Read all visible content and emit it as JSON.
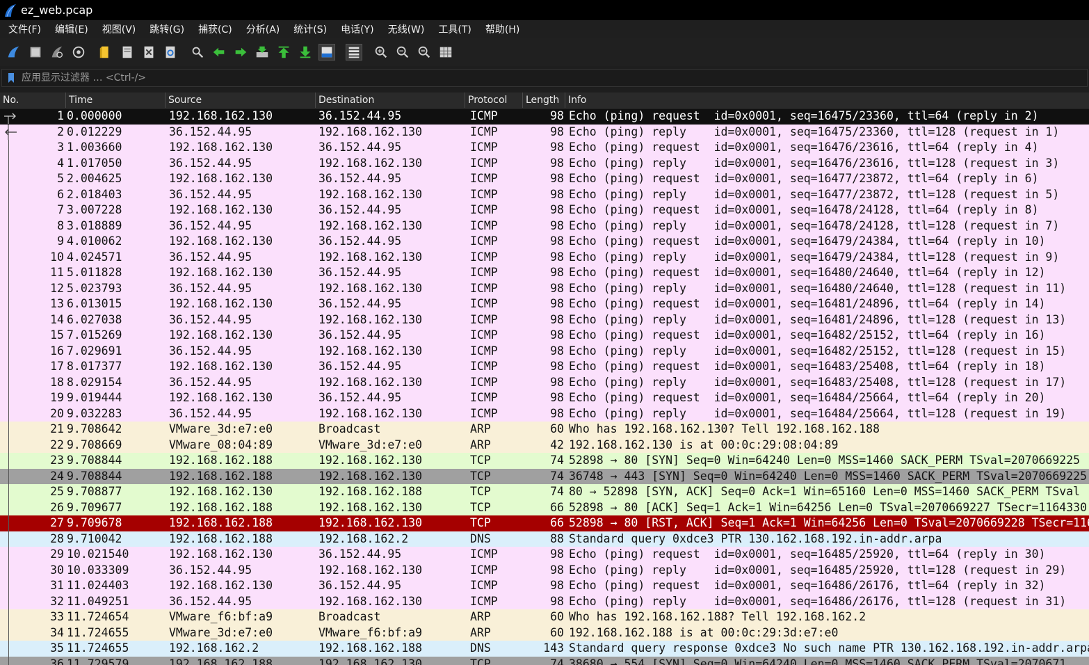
{
  "window": {
    "title": "ez_web.pcap"
  },
  "menu": [
    "文件(F)",
    "编辑(E)",
    "视图(V)",
    "跳转(G)",
    "捕获(C)",
    "分析(A)",
    "统计(S)",
    "电话(Y)",
    "无线(W)",
    "工具(T)",
    "帮助(H)"
  ],
  "toolbar": [
    {
      "name": "start-capture-icon"
    },
    {
      "name": "stop-capture-icon"
    },
    {
      "name": "restart-capture-icon"
    },
    {
      "name": "capture-options-icon"
    },
    {
      "name": "open-file-icon",
      "sep": true
    },
    {
      "name": "save-file-icon"
    },
    {
      "name": "close-file-icon"
    },
    {
      "name": "reload-file-icon"
    },
    {
      "name": "find-packet-icon",
      "sep": true
    },
    {
      "name": "go-back-icon"
    },
    {
      "name": "go-forward-icon"
    },
    {
      "name": "go-to-packet-icon"
    },
    {
      "name": "go-first-packet-icon"
    },
    {
      "name": "go-last-packet-icon"
    },
    {
      "name": "auto-scroll-icon",
      "active": true
    },
    {
      "name": "colorize-icon",
      "sep": true,
      "active": true
    },
    {
      "name": "zoom-in-icon",
      "sep": true
    },
    {
      "name": "zoom-out-icon"
    },
    {
      "name": "zoom-normal-icon"
    },
    {
      "name": "resize-columns-icon"
    }
  ],
  "filter": {
    "placeholder": "应用显示过滤器 … <Ctrl-/>"
  },
  "columns": [
    "No.",
    "Time",
    "Source",
    "Destination",
    "Protocol",
    "Length",
    "Info"
  ],
  "colors": {
    "icmp": "#fbe0fc",
    "arp": "#f9f0d8",
    "tcp": "#e3fbcf",
    "tcp_dim": "#a0a0a0",
    "tcp_rst": "#a50000",
    "dns": "#daeffb",
    "selected": "#101010"
  },
  "packets": [
    {
      "no": "1",
      "time": "0.000000",
      "src": "192.168.162.130",
      "dst": "36.152.44.95",
      "proto": "ICMP",
      "len": "98",
      "info": "Echo (ping) request  id=0x0001, seq=16475/23360, ttl=64 (reply in 2)",
      "color": "selected",
      "rel": "req"
    },
    {
      "no": "2",
      "time": "0.012229",
      "src": "36.152.44.95",
      "dst": "192.168.162.130",
      "proto": "ICMP",
      "len": "98",
      "info": "Echo (ping) reply    id=0x0001, seq=16475/23360, ttl=128 (request in 1)",
      "color": "icmp",
      "rel": "resp"
    },
    {
      "no": "3",
      "time": "1.003660",
      "src": "192.168.162.130",
      "dst": "36.152.44.95",
      "proto": "ICMP",
      "len": "98",
      "info": "Echo (ping) request  id=0x0001, seq=16476/23616, ttl=64 (reply in 4)",
      "color": "icmp",
      "rel": "line"
    },
    {
      "no": "4",
      "time": "1.017050",
      "src": "36.152.44.95",
      "dst": "192.168.162.130",
      "proto": "ICMP",
      "len": "98",
      "info": "Echo (ping) reply    id=0x0001, seq=16476/23616, ttl=128 (request in 3)",
      "color": "icmp",
      "rel": "line"
    },
    {
      "no": "5",
      "time": "2.004625",
      "src": "192.168.162.130",
      "dst": "36.152.44.95",
      "proto": "ICMP",
      "len": "98",
      "info": "Echo (ping) request  id=0x0001, seq=16477/23872, ttl=64 (reply in 6)",
      "color": "icmp",
      "rel": "line"
    },
    {
      "no": "6",
      "time": "2.018403",
      "src": "36.152.44.95",
      "dst": "192.168.162.130",
      "proto": "ICMP",
      "len": "98",
      "info": "Echo (ping) reply    id=0x0001, seq=16477/23872, ttl=128 (request in 5)",
      "color": "icmp",
      "rel": "line"
    },
    {
      "no": "7",
      "time": "3.007228",
      "src": "192.168.162.130",
      "dst": "36.152.44.95",
      "proto": "ICMP",
      "len": "98",
      "info": "Echo (ping) request  id=0x0001, seq=16478/24128, ttl=64 (reply in 8)",
      "color": "icmp",
      "rel": "line"
    },
    {
      "no": "8",
      "time": "3.018889",
      "src": "36.152.44.95",
      "dst": "192.168.162.130",
      "proto": "ICMP",
      "len": "98",
      "info": "Echo (ping) reply    id=0x0001, seq=16478/24128, ttl=128 (request in 7)",
      "color": "icmp",
      "rel": "line"
    },
    {
      "no": "9",
      "time": "4.010062",
      "src": "192.168.162.130",
      "dst": "36.152.44.95",
      "proto": "ICMP",
      "len": "98",
      "info": "Echo (ping) request  id=0x0001, seq=16479/24384, ttl=64 (reply in 10)",
      "color": "icmp",
      "rel": "line"
    },
    {
      "no": "10",
      "time": "4.024571",
      "src": "36.152.44.95",
      "dst": "192.168.162.130",
      "proto": "ICMP",
      "len": "98",
      "info": "Echo (ping) reply    id=0x0001, seq=16479/24384, ttl=128 (request in 9)",
      "color": "icmp",
      "rel": "line"
    },
    {
      "no": "11",
      "time": "5.011828",
      "src": "192.168.162.130",
      "dst": "36.152.44.95",
      "proto": "ICMP",
      "len": "98",
      "info": "Echo (ping) request  id=0x0001, seq=16480/24640, ttl=64 (reply in 12)",
      "color": "icmp",
      "rel": "line"
    },
    {
      "no": "12",
      "time": "5.023793",
      "src": "36.152.44.95",
      "dst": "192.168.162.130",
      "proto": "ICMP",
      "len": "98",
      "info": "Echo (ping) reply    id=0x0001, seq=16480/24640, ttl=128 (request in 11)",
      "color": "icmp",
      "rel": "line"
    },
    {
      "no": "13",
      "time": "6.013015",
      "src": "192.168.162.130",
      "dst": "36.152.44.95",
      "proto": "ICMP",
      "len": "98",
      "info": "Echo (ping) request  id=0x0001, seq=16481/24896, ttl=64 (reply in 14)",
      "color": "icmp",
      "rel": "line"
    },
    {
      "no": "14",
      "time": "6.027038",
      "src": "36.152.44.95",
      "dst": "192.168.162.130",
      "proto": "ICMP",
      "len": "98",
      "info": "Echo (ping) reply    id=0x0001, seq=16481/24896, ttl=128 (request in 13)",
      "color": "icmp",
      "rel": "line"
    },
    {
      "no": "15",
      "time": "7.015269",
      "src": "192.168.162.130",
      "dst": "36.152.44.95",
      "proto": "ICMP",
      "len": "98",
      "info": "Echo (ping) request  id=0x0001, seq=16482/25152, ttl=64 (reply in 16)",
      "color": "icmp",
      "rel": "line"
    },
    {
      "no": "16",
      "time": "7.029691",
      "src": "36.152.44.95",
      "dst": "192.168.162.130",
      "proto": "ICMP",
      "len": "98",
      "info": "Echo (ping) reply    id=0x0001, seq=16482/25152, ttl=128 (request in 15)",
      "color": "icmp",
      "rel": "line"
    },
    {
      "no": "17",
      "time": "8.017377",
      "src": "192.168.162.130",
      "dst": "36.152.44.95",
      "proto": "ICMP",
      "len": "98",
      "info": "Echo (ping) request  id=0x0001, seq=16483/25408, ttl=64 (reply in 18)",
      "color": "icmp",
      "rel": "line"
    },
    {
      "no": "18",
      "time": "8.029154",
      "src": "36.152.44.95",
      "dst": "192.168.162.130",
      "proto": "ICMP",
      "len": "98",
      "info": "Echo (ping) reply    id=0x0001, seq=16483/25408, ttl=128 (request in 17)",
      "color": "icmp",
      "rel": "line"
    },
    {
      "no": "19",
      "time": "9.019444",
      "src": "192.168.162.130",
      "dst": "36.152.44.95",
      "proto": "ICMP",
      "len": "98",
      "info": "Echo (ping) request  id=0x0001, seq=16484/25664, ttl=64 (reply in 20)",
      "color": "icmp",
      "rel": "line"
    },
    {
      "no": "20",
      "time": "9.032283",
      "src": "36.152.44.95",
      "dst": "192.168.162.130",
      "proto": "ICMP",
      "len": "98",
      "info": "Echo (ping) reply    id=0x0001, seq=16484/25664, ttl=128 (request in 19)",
      "color": "icmp",
      "rel": "line"
    },
    {
      "no": "21",
      "time": "9.708642",
      "src": "VMware_3d:e7:e0",
      "dst": "Broadcast",
      "proto": "ARP",
      "len": "60",
      "info": "Who has 192.168.162.130? Tell 192.168.162.188",
      "color": "arp",
      "rel": "line"
    },
    {
      "no": "22",
      "time": "9.708669",
      "src": "VMware_08:04:89",
      "dst": "VMware_3d:e7:e0",
      "proto": "ARP",
      "len": "42",
      "info": "192.168.162.130 is at 00:0c:29:08:04:89",
      "color": "arp",
      "rel": "line"
    },
    {
      "no": "23",
      "time": "9.708844",
      "src": "192.168.162.188",
      "dst": "192.168.162.130",
      "proto": "TCP",
      "len": "74",
      "info": "52898 → 80 [SYN] Seq=0 Win=64240 Len=0 MSS=1460 SACK_PERM TSval=2070669225",
      "color": "tcp",
      "rel": "line"
    },
    {
      "no": "24",
      "time": "9.708844",
      "src": "192.168.162.188",
      "dst": "192.168.162.130",
      "proto": "TCP",
      "len": "74",
      "info": "36748 → 443 [SYN] Seq=0 Win=64240 Len=0 MSS=1460 SACK_PERM TSval=2070669225",
      "color": "tcp_dim",
      "rel": "line"
    },
    {
      "no": "25",
      "time": "9.708877",
      "src": "192.168.162.130",
      "dst": "192.168.162.188",
      "proto": "TCP",
      "len": "74",
      "info": "80 → 52898 [SYN, ACK] Seq=0 Ack=1 Win=65160 Len=0 MSS=1460 SACK_PERM TSval",
      "color": "tcp",
      "rel": "line"
    },
    {
      "no": "26",
      "time": "9.709677",
      "src": "192.168.162.188",
      "dst": "192.168.162.130",
      "proto": "TCP",
      "len": "66",
      "info": "52898 → 80 [ACK] Seq=1 Ack=1 Win=64256 Len=0 TSval=2070669227 TSecr=1164330",
      "color": "tcp",
      "rel": "line"
    },
    {
      "no": "27",
      "time": "9.709678",
      "src": "192.168.162.188",
      "dst": "192.168.162.130",
      "proto": "TCP",
      "len": "66",
      "info": "52898 → 80 [RST, ACK] Seq=1 Ack=1 Win=64256 Len=0 TSval=2070669228 TSecr=116",
      "color": "tcp_rst",
      "rel": "line"
    },
    {
      "no": "28",
      "time": "9.710042",
      "src": "192.168.162.188",
      "dst": "192.168.162.2",
      "proto": "DNS",
      "len": "88",
      "info": "Standard query 0xdce3 PTR 130.162.168.192.in-addr.arpa",
      "color": "dns",
      "rel": "line"
    },
    {
      "no": "29",
      "time": "10.021540",
      "src": "192.168.162.130",
      "dst": "36.152.44.95",
      "proto": "ICMP",
      "len": "98",
      "info": "Echo (ping) request  id=0x0001, seq=16485/25920, ttl=64 (reply in 30)",
      "color": "icmp",
      "rel": "line"
    },
    {
      "no": "30",
      "time": "10.033309",
      "src": "36.152.44.95",
      "dst": "192.168.162.130",
      "proto": "ICMP",
      "len": "98",
      "info": "Echo (ping) reply    id=0x0001, seq=16485/25920, ttl=128 (request in 29)",
      "color": "icmp",
      "rel": "line"
    },
    {
      "no": "31",
      "time": "11.024403",
      "src": "192.168.162.130",
      "dst": "36.152.44.95",
      "proto": "ICMP",
      "len": "98",
      "info": "Echo (ping) request  id=0x0001, seq=16486/26176, ttl=64 (reply in 32)",
      "color": "icmp",
      "rel": "line"
    },
    {
      "no": "32",
      "time": "11.049251",
      "src": "36.152.44.95",
      "dst": "192.168.162.130",
      "proto": "ICMP",
      "len": "98",
      "info": "Echo (ping) reply    id=0x0001, seq=16486/26176, ttl=128 (request in 31)",
      "color": "icmp",
      "rel": "line"
    },
    {
      "no": "33",
      "time": "11.724654",
      "src": "VMware_f6:bf:a9",
      "dst": "Broadcast",
      "proto": "ARP",
      "len": "60",
      "info": "Who has 192.168.162.188? Tell 192.168.162.2",
      "color": "arp",
      "rel": "line"
    },
    {
      "no": "34",
      "time": "11.724655",
      "src": "VMware_3d:e7:e0",
      "dst": "VMware_f6:bf:a9",
      "proto": "ARP",
      "len": "60",
      "info": "192.168.162.188 is at 00:0c:29:3d:e7:e0",
      "color": "arp",
      "rel": "line"
    },
    {
      "no": "35",
      "time": "11.724655",
      "src": "192.168.162.2",
      "dst": "192.168.162.188",
      "proto": "DNS",
      "len": "143",
      "info": "Standard query response 0xdce3 No such name PTR 130.162.168.192.in-addr.arpa",
      "color": "dns",
      "rel": "line"
    },
    {
      "no": "36",
      "time": "11.729579",
      "src": "192.168.162.188",
      "dst": "192.168.162.130",
      "proto": "TCP",
      "len": "74",
      "info": "38680 → 554 [SYN] Seq=0 Win=64240 Len=0 MSS=1460 SACK_PERM TSval=2070671",
      "color": "tcp_dim",
      "rel": "line"
    }
  ]
}
